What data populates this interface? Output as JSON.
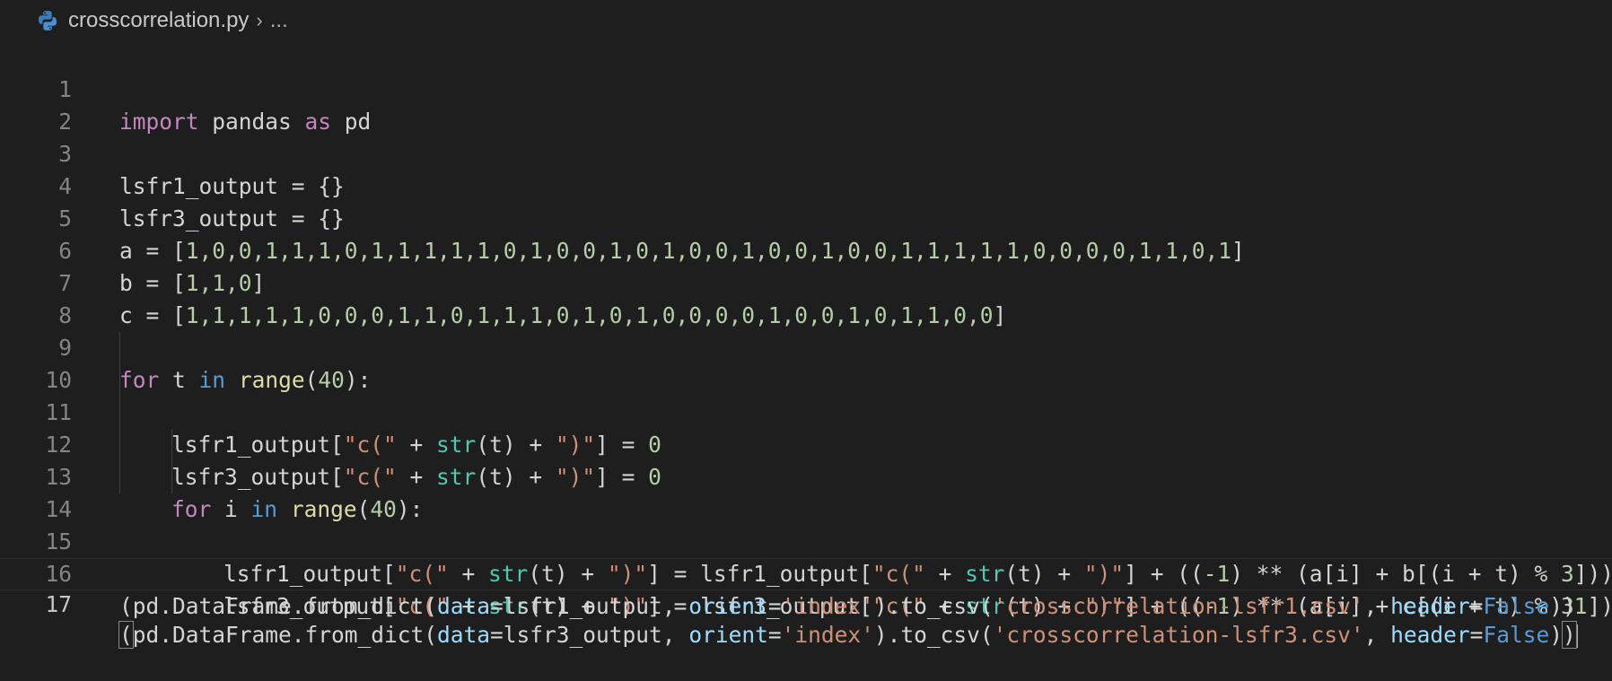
{
  "breadcrumb": {
    "file_name": "crosscorrelation.py",
    "separator": "›",
    "more": "...",
    "file_icon": "python-icon"
  },
  "editor": {
    "line_numbers": [
      "1",
      "2",
      "3",
      "4",
      "5",
      "6",
      "7",
      "8",
      "9",
      "10",
      "11",
      "12",
      "13",
      "14",
      "15",
      "16",
      "17"
    ],
    "current_line": 17,
    "lines": {
      "l1": [
        "import",
        " pandas ",
        "as",
        " pd"
      ],
      "l3": [
        "lsfr1_output = {}"
      ],
      "l4": [
        "lsfr3_output = {}"
      ],
      "l5": [
        "a = [",
        "1,0,0,1,1,1,0,1,1,1,1,1,0,1,0,0,1,0,1,0,0,1,0,0,1,0,0,1,1,1,1,1,0,0,0,0,1,1,0,1",
        "]"
      ],
      "l6": [
        "b = [",
        "1,1,0",
        "]"
      ],
      "l7": [
        "c = [",
        "1,1,1,1,1,0,0,0,1,1,0,1,1,1,0,1,0,1,0,0,0,0,1,0,0,1,0,1,1,0,0",
        "]"
      ],
      "l9": [
        "for",
        " t ",
        "in",
        " ",
        "range",
        "(",
        "40",
        "):"
      ],
      "l10": [
        "lsfr1_output[",
        "\"c(\"",
        " + ",
        "str",
        "(t) + ",
        "\")\"",
        "] = ",
        "0"
      ],
      "l11": [
        "lsfr3_output[",
        "\"c(\"",
        " + ",
        "str",
        "(t) + ",
        "\")\"",
        "] = ",
        "0"
      ],
      "l12": [
        "for",
        " i ",
        "in",
        " ",
        "range",
        "(",
        "40",
        "):"
      ],
      "l13": [
        "lsfr1_output[",
        "\"c(\"",
        " + ",
        "str",
        "(t) + ",
        "\")\"",
        "] = lsfr1_output[",
        "\"c(\"",
        " + ",
        "str",
        "(t) + ",
        "\")\"",
        "] + ((",
        "-1",
        ") ** (a[i] + b[(i + t) % ",
        "3",
        "]))"
      ],
      "l14": [
        "lsfr3_output[",
        "\"c(\"",
        " + ",
        "str",
        "(t) + ",
        "\")\"",
        "] = lsfr3_output[",
        "\"c(\"",
        " + ",
        "str",
        "(t) + ",
        "\")\"",
        "] + ((",
        "-1",
        ") ** (a[i] + c[(i + t) % ",
        "31",
        "]))"
      ],
      "l16": [
        "(pd.DataFrame.from_dict(",
        "data",
        "=lsfr1_output, ",
        "orient",
        "=",
        "'index'",
        ").to_csv(",
        "'crosscorrelation-lsfr1.csv'",
        ", ",
        "header",
        "=",
        "False",
        "))"
      ],
      "l17": [
        "(",
        "pd.DataFrame.from_dict(",
        "data",
        "=lsfr3_output, ",
        "orient",
        "=",
        "'index'",
        ").to_csv(",
        "'crosscorrelation-lsfr3.csv'",
        ", ",
        "header",
        "=",
        "False",
        ")",
        ")"
      ]
    }
  },
  "colors": {
    "background": "#1e1e1e",
    "keyword_control": "#c586c0",
    "keyword": "#569cd6",
    "function": "#dcdcaa",
    "builtin": "#4ec9b0",
    "string": "#ce9178",
    "number": "#b5cea8",
    "parameter": "#9cdcfe",
    "line_number": "#858585"
  }
}
